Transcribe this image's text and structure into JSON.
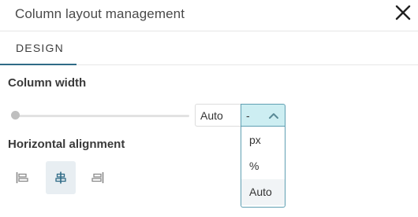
{
  "dialog": {
    "title": "Column layout management",
    "close_icon": "close-icon"
  },
  "tabs": [
    {
      "label": "DESIGN",
      "active": true
    }
  ],
  "column_width": {
    "label": "Column width",
    "slider_level": 0,
    "input_value": "Auto",
    "unit_selected": "-",
    "unit_options": [
      "px",
      "%",
      "Auto"
    ],
    "dropdown_open": true
  },
  "horizontal_alignment": {
    "label": "Horizontal alignment",
    "options": [
      {
        "icon": "align-left-icon",
        "selected": false
      },
      {
        "icon": "align-center-icon",
        "selected": true
      },
      {
        "icon": "align-right-icon",
        "selected": false
      }
    ]
  },
  "colors": {
    "accent": "#2f6b86",
    "select_bg": "#cdeef2",
    "select_border": "#5f9fb2",
    "selected_align_bg": "#e8eef2"
  }
}
